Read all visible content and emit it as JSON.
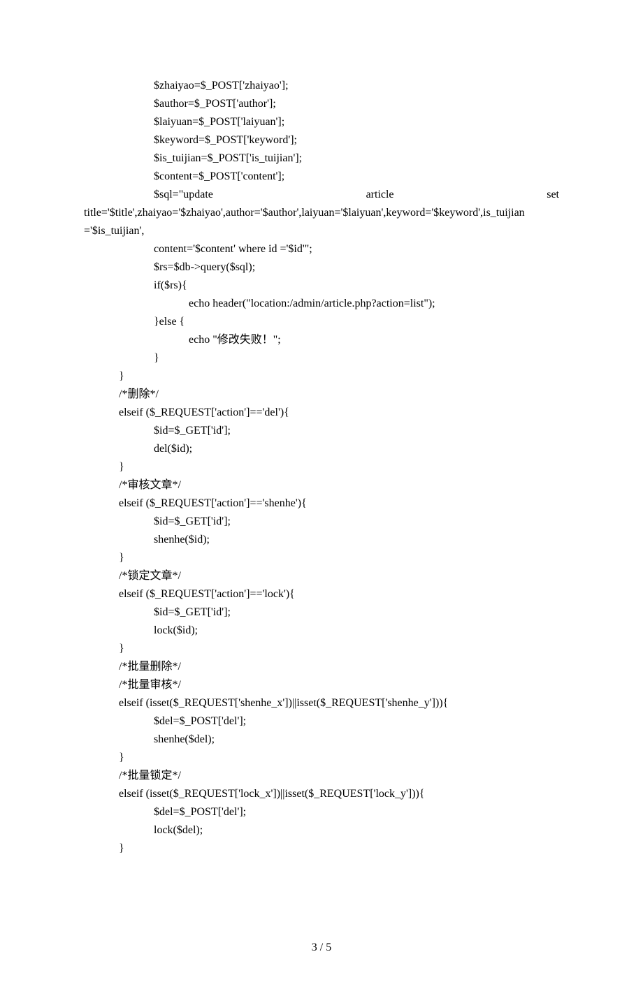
{
  "lines": [
    {
      "indent": 2,
      "text": "$zhaiyao=$_POST['zhaiyao'];"
    },
    {
      "indent": 2,
      "text": "$author=$_POST['author'];"
    },
    {
      "indent": 2,
      "text": "$laiyuan=$_POST['laiyuan'];"
    },
    {
      "indent": 2,
      "text": "$keyword=$_POST['keyword'];"
    },
    {
      "indent": 2,
      "text": "$is_tuijian=$_POST['is_tuijian'];"
    },
    {
      "indent": 2,
      "text": "$content=$_POST['content'];"
    },
    {
      "indent": 2,
      "justify": true,
      "parts": [
        "$sql=\"update",
        "article",
        "set"
      ]
    },
    {
      "indent": 0,
      "text": "title='$title',zhaiyao='$zhaiyao',author='$author',laiyuan='$laiyuan',keyword='$keyword',is_tuijian"
    },
    {
      "indent": 0,
      "text": "='$is_tuijian',"
    },
    {
      "indent": 2,
      "text": "content='$content' where id ='$id'\";"
    },
    {
      "indent": 2,
      "text": "$rs=$db->query($sql);"
    },
    {
      "indent": 2,
      "text": "if($rs){"
    },
    {
      "indent": 3,
      "text": "echo header(\"location:/admin/article.php?action=list\");"
    },
    {
      "indent": 2,
      "text": "}else {"
    },
    {
      "indent": 3,
      "text": "echo \"修改失败！\";"
    },
    {
      "indent": 2,
      "text": "}"
    },
    {
      "indent": 1,
      "text": "}"
    },
    {
      "indent": 1,
      "text": "/*删除*/"
    },
    {
      "indent": 1,
      "text": "elseif ($_REQUEST['action']=='del'){"
    },
    {
      "indent": 2,
      "text": "$id=$_GET['id'];"
    },
    {
      "indent": 2,
      "text": "del($id);"
    },
    {
      "indent": 1,
      "text": "}"
    },
    {
      "indent": 1,
      "text": "/*审核文章*/"
    },
    {
      "indent": 1,
      "text": "elseif ($_REQUEST['action']=='shenhe'){"
    },
    {
      "indent": 2,
      "text": "$id=$_GET['id'];"
    },
    {
      "indent": 2,
      "text": "shenhe($id);"
    },
    {
      "indent": 1,
      "text": "}"
    },
    {
      "indent": 1,
      "text": "/*锁定文章*/"
    },
    {
      "indent": 1,
      "text": "elseif ($_REQUEST['action']=='lock'){"
    },
    {
      "indent": 2,
      "text": "$id=$_GET['id'];"
    },
    {
      "indent": 2,
      "text": "lock($id);"
    },
    {
      "indent": 1,
      "text": "}"
    },
    {
      "indent": 1,
      "text": "/*批量删除*/"
    },
    {
      "indent": 1,
      "text": "/*批量审核*/"
    },
    {
      "indent": 1,
      "text": "elseif (isset($_REQUEST['shenhe_x'])||isset($_REQUEST['shenhe_y'])){"
    },
    {
      "indent": 2,
      "text": "$del=$_POST['del'];"
    },
    {
      "indent": 2,
      "text": "shenhe($del);"
    },
    {
      "indent": 1,
      "text": "}"
    },
    {
      "indent": 1,
      "text": "/*批量锁定*/"
    },
    {
      "indent": 1,
      "text": "elseif (isset($_REQUEST['lock_x'])||isset($_REQUEST['lock_y'])){"
    },
    {
      "indent": 2,
      "text": "$del=$_POST['del'];"
    },
    {
      "indent": 2,
      "text": "lock($del);"
    },
    {
      "indent": 1,
      "text": "}"
    }
  ],
  "footer": "3 / 5"
}
